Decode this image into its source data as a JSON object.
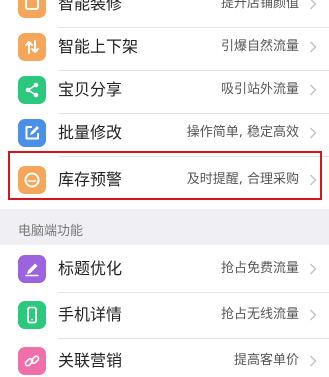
{
  "colors": {
    "orange": "#f5a65b",
    "green": "#2cc87d",
    "blue": "#4a90e6",
    "purple": "#9b63e0",
    "pink": "#ef6fa8",
    "highlight_border": "#d7141d"
  },
  "sections": [
    {
      "header": "",
      "items": [
        {
          "title": "智能装修",
          "desc": "提升店铺颜值",
          "icon": "decor-icon"
        },
        {
          "title": "智能上下架",
          "desc": "引爆自然流量",
          "icon": "up-down-arrows-icon"
        },
        {
          "title": "宝贝分享",
          "desc": "吸引站外流量",
          "icon": "share-icon"
        },
        {
          "title": "批量修改",
          "desc": "操作简单, 稳定高效",
          "icon": "edit-square-icon"
        },
        {
          "title": "库存预警",
          "desc": "及时提醒, 合理采购",
          "icon": "stock-alert-icon"
        }
      ]
    },
    {
      "header": "电脑端功能",
      "items": [
        {
          "title": "标题优化",
          "desc": "抢占免费流量",
          "icon": "pen-icon"
        },
        {
          "title": "手机详情",
          "desc": "抢占无线流量",
          "icon": "phone-icon"
        },
        {
          "title": "关联营销",
          "desc": "提高客单价",
          "icon": "link-icon"
        }
      ]
    }
  ]
}
